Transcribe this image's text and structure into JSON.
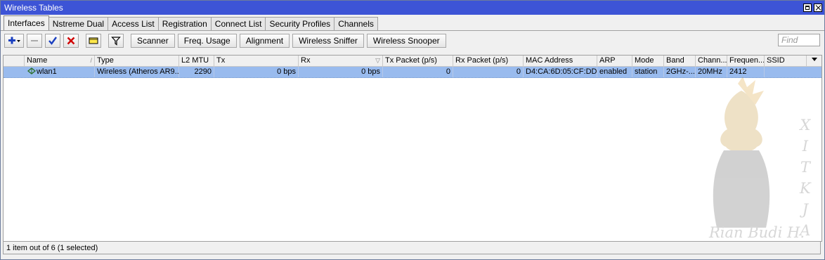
{
  "window": {
    "title": "Wireless Tables"
  },
  "tabs": [
    "Interfaces",
    "Nstreme Dual",
    "Access List",
    "Registration",
    "Connect List",
    "Security Profiles",
    "Channels"
  ],
  "toolbar": {
    "buttons": [
      "Scanner",
      "Freq. Usage",
      "Alignment",
      "Wireless Sniffer",
      "Wireless Snooper"
    ],
    "find_placeholder": "Find"
  },
  "table": {
    "columns": [
      "Name",
      "Type",
      "L2 MTU",
      "Tx",
      "Rx",
      "Tx Packet (p/s)",
      "Rx Packet (p/s)",
      "MAC Address",
      "ARP",
      "Mode",
      "Band",
      "Chann...",
      "Frequen...",
      "SSID"
    ],
    "rows": [
      {
        "name": "wlan1",
        "type": "Wireless (Atheros AR9...",
        "l2mtu": "2290",
        "tx": "0 bps",
        "rx": "0 bps",
        "tx_packet": "0",
        "rx_packet": "0",
        "mac": "D4:CA:6D:05:CF:DD",
        "arp": "enabled",
        "mode": "station",
        "band": "2GHz-...",
        "channel": "20MHz",
        "frequency": "2412",
        "ssid": ""
      }
    ]
  },
  "status": "1 item out of 6 (1 selected)",
  "watermark": {
    "vertical": [
      "X",
      "I",
      "T",
      "K",
      "J",
      "A"
    ],
    "signature": "Rian Budi H."
  },
  "colors": {
    "titlebar": "#3d54d6",
    "selected_row": "#99bbee",
    "add_icon": "#1a3fbf",
    "remove_icon": "#d00000"
  }
}
